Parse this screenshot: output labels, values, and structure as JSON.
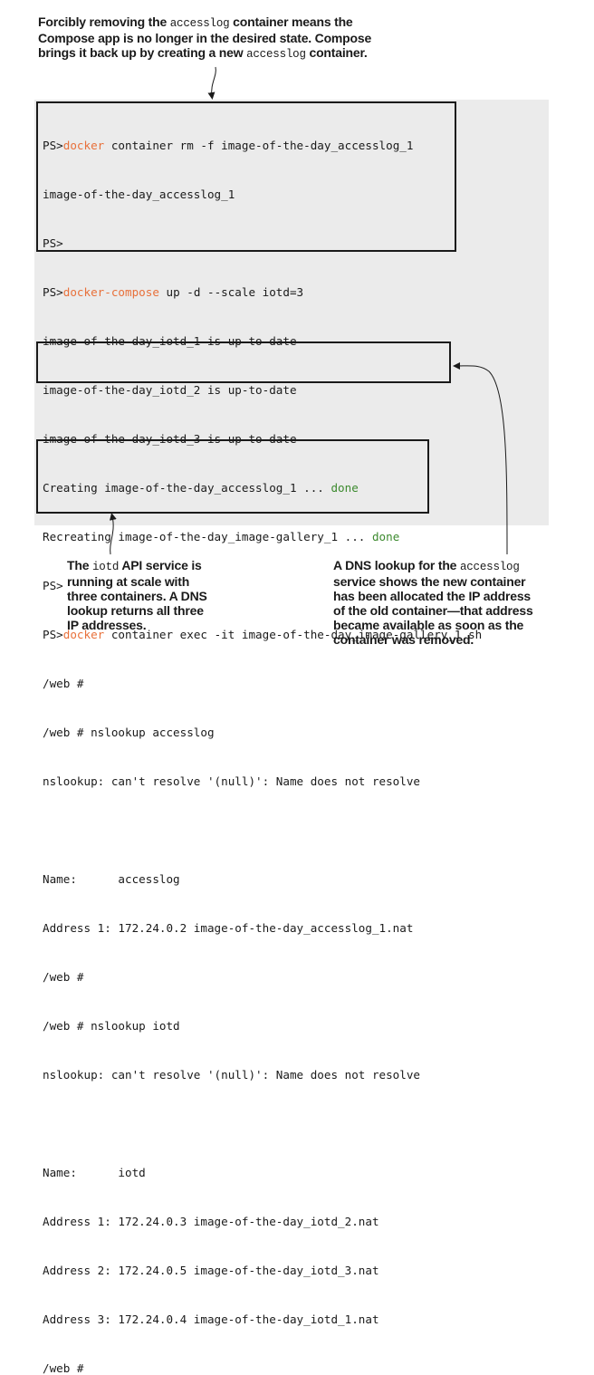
{
  "callouts": {
    "top": {
      "line1_pre": "Forcibly removing the ",
      "line1_code": "accesslog",
      "line1_post": " container means the",
      "line2": "Compose app is no longer in the desired state. Compose",
      "line3_pre": "brings it back up by creating a new ",
      "line3_code": "accesslog",
      "line3_post": " container."
    },
    "left": {
      "line1_pre": "The ",
      "line1_code": "iotd",
      "line1_post": " API service is",
      "line2": "running at scale with",
      "line3": "three containers. A DNS",
      "line4": "lookup returns all three",
      "line5": "IP addresses."
    },
    "right": {
      "line1_pre": "A DNS lookup for the ",
      "line1_code": "accesslog",
      "line2": "service shows the new container",
      "line3": "has been allocated the IP address",
      "line4": "of the old container—that address",
      "line5": "became available as soon as the",
      "line6": "container was removed."
    }
  },
  "terminal": {
    "l1_prompt": "PS>",
    "l1_cmd": "docker",
    "l1_rest": " container rm -f image-of-the-day_accesslog_1",
    "l2": "image-of-the-day_accesslog_1",
    "l3": "PS>",
    "l4_prompt": "PS>",
    "l4_cmd": "docker-compose",
    "l4_rest": " up -d --scale iotd=3",
    "l5": "image-of-the-day_iotd_1 is up-to-date",
    "l6": "image-of-the-day_iotd_2 is up-to-date",
    "l7": "image-of-the-day_iotd_3 is up-to-date",
    "l8_text": "Creating image-of-the-day_accesslog_1 ... ",
    "l8_status": "done",
    "l9_text": "Recreating image-of-the-day_image-gallery_1 ... ",
    "l9_status": "done",
    "l10": "PS>",
    "l11_prompt": "PS>",
    "l11_cmd": "docker",
    "l11_rest": " container exec -it image-of-the-day_image-gallery_1 sh",
    "l12": "/web #",
    "l13": "/web # nslookup accesslog",
    "l14": "nslookup: can't resolve '(null)': Name does not resolve",
    "l15": "",
    "l16": "Name:      accesslog",
    "l17": "Address 1: 172.24.0.2 image-of-the-day_accesslog_1.nat",
    "l18": "/web #",
    "l19": "/web # nslookup iotd",
    "l20": "nslookup: can't resolve '(null)': Name does not resolve",
    "l21": "",
    "l22": "Name:      iotd",
    "l23": "Address 1: 172.24.0.3 image-of-the-day_iotd_2.nat",
    "l24": "Address 2: 172.24.0.5 image-of-the-day_iotd_3.nat",
    "l25": "Address 3: 172.24.0.4 image-of-the-day_iotd_1.nat",
    "l26": "/web #"
  },
  "colors": {
    "command": "#e8703a",
    "done": "#3c8a2e",
    "terminal_bg": "#ebebeb"
  }
}
